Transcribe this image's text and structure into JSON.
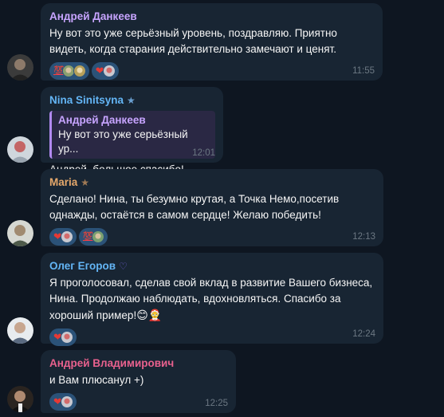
{
  "messages": [
    {
      "sender": "Андрей Данкеев",
      "sender_color": "#c7a4ff",
      "text": "Ну вот это уже серьёзный уровень, поздравляю. Приятно видеть, когда старания действительно замечают и ценят.",
      "time": "11:55",
      "reactions": [
        "💯",
        "❤"
      ]
    },
    {
      "sender": "Nina Sinitsyna",
      "sender_color": "#63b5f5",
      "sender_badge": "★",
      "quote_name": "Андрей Данкеев",
      "quote_text": "Ну вот это уже серьёзный ур...",
      "text": "Андрей, большое спасибо!",
      "time": "12:01"
    },
    {
      "sender": "Maria",
      "sender_color": "#e5a86b",
      "sender_badge": "★",
      "text": "Сделано! Нина, ты безумно крутая, а Точка Немо,посетив однажды, остаётся в самом сердце! Желаю победить!",
      "time": "12:13",
      "reactions": [
        "❤",
        "💯"
      ]
    },
    {
      "sender": "Олег Егоров",
      "sender_color": "#63b5f5",
      "sender_badge": "♡",
      "text": "Я проголосовал, сделав свой вклад в развитие Вашего бизнеса, Нина. Продолжаю наблюдать, вдохновляться. Спасибо за хороший пример!",
      "text_emojis": "😊🤶",
      "time": "12:24",
      "reactions": [
        "❤"
      ]
    },
    {
      "sender": "Андрей Владимирович",
      "sender_color": "#e9618e",
      "text": "и Вам плюсанул +)",
      "time": "12:25",
      "reactions": [
        "❤"
      ]
    }
  ]
}
